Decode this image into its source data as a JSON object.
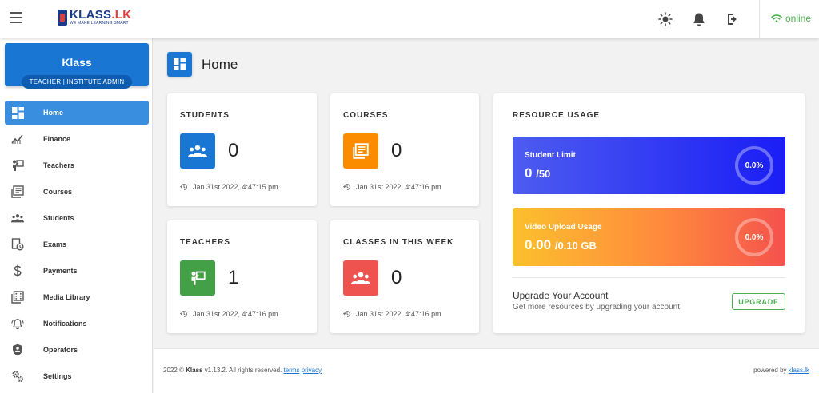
{
  "brand": {
    "logo_main": "KLASS",
    "logo_suffix": ".LK",
    "tagline": "WE MAKE LEARNING SMART"
  },
  "topbar": {
    "status": "online"
  },
  "profile": {
    "name": "Klass",
    "role": "TEACHER | INSTITUTE ADMIN"
  },
  "sidebar": {
    "items": [
      {
        "label": "Home",
        "icon": "dashboard-icon",
        "active": true
      },
      {
        "label": "Finance",
        "icon": "chart-icon"
      },
      {
        "label": "Teachers",
        "icon": "teacher-icon"
      },
      {
        "label": "Courses",
        "icon": "courses-icon"
      },
      {
        "label": "Students",
        "icon": "people-icon"
      },
      {
        "label": "Exams",
        "icon": "exam-icon"
      },
      {
        "label": "Payments",
        "icon": "dollar-icon"
      },
      {
        "label": "Media Library",
        "icon": "media-library-icon"
      },
      {
        "label": "Notifications",
        "icon": "bell-icon"
      },
      {
        "label": "Operators",
        "icon": "shield-icon"
      },
      {
        "label": "Settings",
        "icon": "gears-icon"
      }
    ]
  },
  "page": {
    "title": "Home"
  },
  "stats": {
    "students": {
      "title": "STUDENTS",
      "value": "0",
      "time": "Jan 31st 2022, 4:47:15 pm"
    },
    "courses": {
      "title": "COURSES",
      "value": "0",
      "time": "Jan 31st 2022, 4:47:16 pm"
    },
    "teachers": {
      "title": "TEACHERS",
      "value": "1",
      "time": "Jan 31st 2022, 4:47:16 pm"
    },
    "classes": {
      "title": "CLASSES IN THIS WEEK",
      "value": "0",
      "time": "Jan 31st 2022, 4:47:16 pm"
    }
  },
  "resource": {
    "title": "RESOURCE USAGE",
    "student_limit": {
      "label": "Student Limit",
      "value": "0",
      "unit": "/50",
      "percent": "0.0%"
    },
    "video_upload": {
      "label": "Video Upload Usage",
      "value": "0.00",
      "unit": "/0.10 GB",
      "percent": "0.0%"
    },
    "upgrade_title": "Upgrade Your Account",
    "upgrade_sub": "Get more resources by upgrading your account",
    "upgrade_button": "UPGRADE"
  },
  "footer": {
    "year": "2022 ©",
    "brand": "Klass",
    "version": "v1.13.2. All rights reserved.",
    "terms": "terms",
    "privacy": "privacy",
    "powered_by": "powered by",
    "powered_link": "klass.lk"
  },
  "colors": {
    "primary": "#1976d2",
    "students_icon": "#1976d2",
    "courses_icon": "#fb8c00",
    "teachers_icon": "#43a047",
    "classes_icon": "#ef5350",
    "online": "#4caf50"
  }
}
